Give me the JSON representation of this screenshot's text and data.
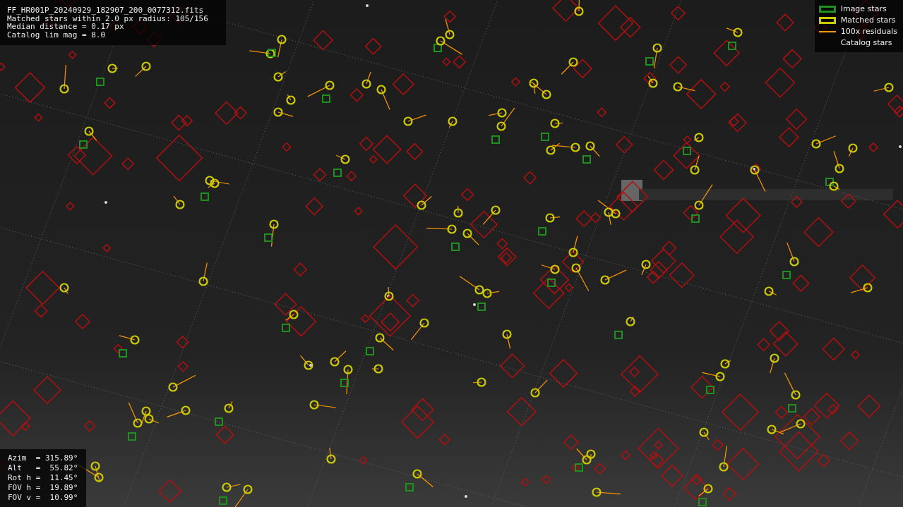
{
  "info": {
    "lines": [
      "FF_HR001P_20240929_182907_200_0077312.fits",
      "Matched stars within 2.0 px radius: 105/156",
      "Median distance = 0.17 px",
      "Catalog lim mag = 8.0"
    ]
  },
  "legend": [
    {
      "kind": "box",
      "color": "#1f8f1f",
      "label": "Image stars"
    },
    {
      "kind": "box",
      "color": "#cccc00",
      "label": "Matched stars"
    },
    {
      "kind": "line",
      "color": "#ff9900",
      "label": "100x residuals"
    },
    {
      "kind": "none",
      "label": "Catalog stars"
    }
  ],
  "pointing": [
    "Azim  = 315.89°",
    "Alt   =  55.82°",
    "Rot h =  11.45°",
    "FOV h =  19.89°",
    "FOV v =  10.99°"
  ]
}
